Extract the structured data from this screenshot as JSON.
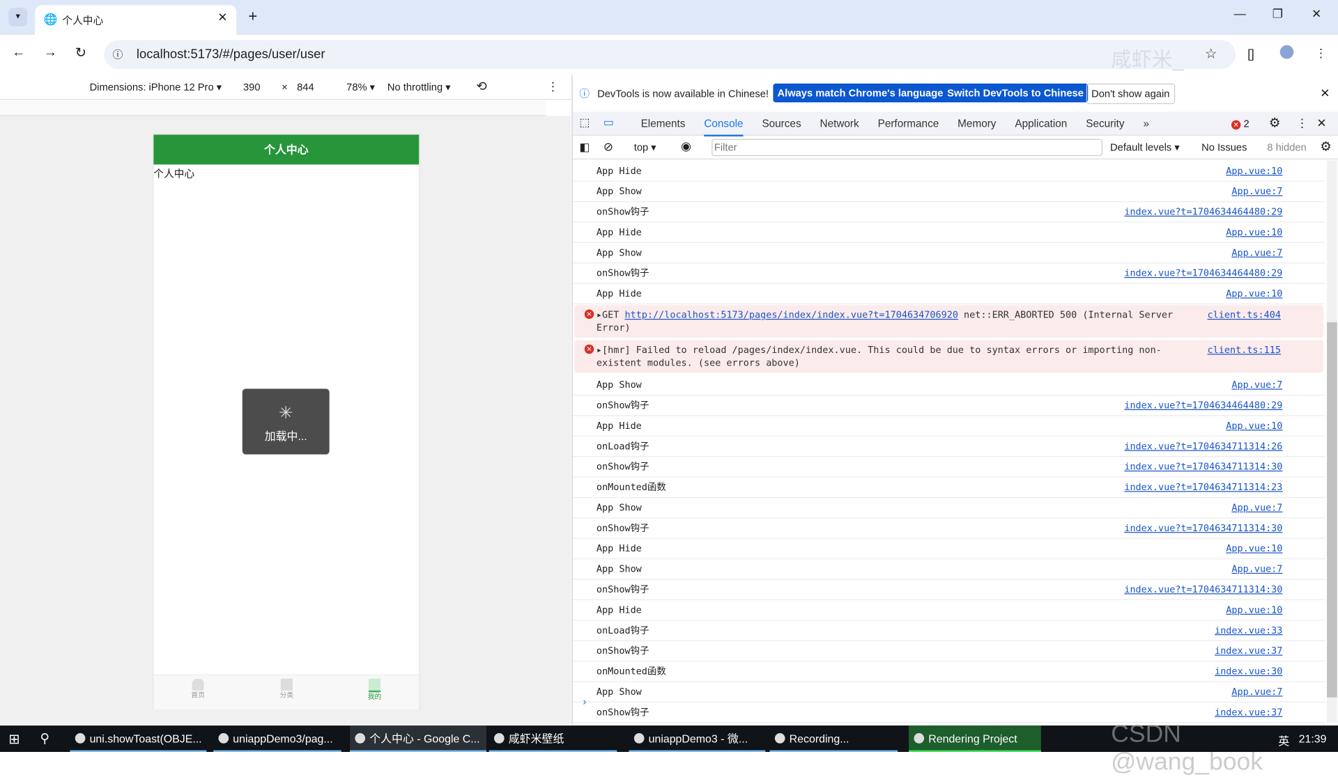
{
  "browser": {
    "tab_title": "个人中心",
    "url": "localhost:5173/#/pages/user/user",
    "watermark": "咸虾米_"
  },
  "device_toolbar": {
    "dimensions": "Dimensions: iPhone 12 Pro",
    "width": "390",
    "x": "×",
    "height": "844",
    "zoom": "78%",
    "throttling": "No throttling"
  },
  "phone": {
    "nav_title": "个人中心",
    "content_text": "个人中心",
    "toast_text": "加载中...",
    "tabbar": [
      {
        "label": "首页"
      },
      {
        "label": "分类"
      },
      {
        "label": "我的"
      }
    ],
    "accent": "#27963b"
  },
  "infobar": {
    "message": "DevTools is now available in Chinese!",
    "btn_match": "Always match Chrome's language",
    "btn_switch": "Switch DevTools to Chinese",
    "btn_dont": "Don't show again"
  },
  "devtools": {
    "tabs": [
      "Elements",
      "Console",
      "Sources",
      "Network",
      "Performance",
      "Memory",
      "Application",
      "Security"
    ],
    "active_tab": "Console",
    "more": "»",
    "error_count": "2"
  },
  "console_toolbar": {
    "context": "top",
    "filter_placeholder": "Filter",
    "levels": "Default levels",
    "issues": "No Issues",
    "hidden": "8 hidden"
  },
  "console": [
    {
      "text": "App Hide",
      "src": "App.vue:10"
    },
    {
      "text": "App Show",
      "src": "App.vue:7"
    },
    {
      "text": "onShow钩子",
      "src": "index.vue?t=1704634464480:29"
    },
    {
      "text": "App Hide",
      "src": "App.vue:10"
    },
    {
      "text": "App Show",
      "src": "App.vue:7"
    },
    {
      "text": "onShow钩子",
      "src": "index.vue?t=1704634464480:29"
    },
    {
      "text": "App Hide",
      "src": "App.vue:10"
    },
    {
      "type": "error",
      "prefix": "GET ",
      "link": "http://localhost:5173/pages/index/index.vue?t=1704634706920",
      "text": " net::ERR_ABORTED 500 (Internal Server Error)",
      "src": "client.ts:404"
    },
    {
      "type": "error",
      "prefix": "",
      "link": "",
      "text": "[hmr] Failed to reload /pages/index/index.vue. This could be due to syntax errors or importing non-existent modules. (see errors above)",
      "src": "client.ts:115"
    },
    {
      "text": "App Show",
      "src": "App.vue:7"
    },
    {
      "text": "onShow钩子",
      "src": "index.vue?t=1704634464480:29"
    },
    {
      "text": "App Hide",
      "src": "App.vue:10"
    },
    {
      "text": "onLoad钩子",
      "src": "index.vue?t=1704634711314:26"
    },
    {
      "text": "onShow钩子",
      "src": "index.vue?t=1704634711314:30"
    },
    {
      "text": "onMounted函数",
      "src": "index.vue?t=1704634711314:23"
    },
    {
      "text": "App Show",
      "src": "App.vue:7"
    },
    {
      "text": "onShow钩子",
      "src": "index.vue?t=1704634711314:30"
    },
    {
      "text": "App Hide",
      "src": "App.vue:10"
    },
    {
      "text": "App Show",
      "src": "App.vue:7"
    },
    {
      "text": "onShow钩子",
      "src": "index.vue?t=1704634711314:30"
    },
    {
      "text": "App Hide",
      "src": "App.vue:10"
    },
    {
      "text": "onLoad钩子",
      "src": "index.vue:33"
    },
    {
      "text": "onShow钩子",
      "src": "index.vue:37"
    },
    {
      "text": "onMounted函数",
      "src": "index.vue:30"
    },
    {
      "text": "App Show",
      "src": "App.vue:7"
    },
    {
      "text": "onShow钩子",
      "src": "index.vue:37"
    }
  ],
  "taskbar": {
    "items": [
      {
        "label": "uni.showToast(OBJE..."
      },
      {
        "label": "uniappDemo3/pag..."
      },
      {
        "label": "个人中心 - Google C..."
      },
      {
        "label": "咸虾米壁纸"
      },
      {
        "label": "uniappDemo3 - 微..."
      },
      {
        "label": "Recording..."
      },
      {
        "label": "Rendering Project"
      }
    ],
    "ime": "英",
    "time": "21:39",
    "watermark": "CSDN @wang_book"
  }
}
